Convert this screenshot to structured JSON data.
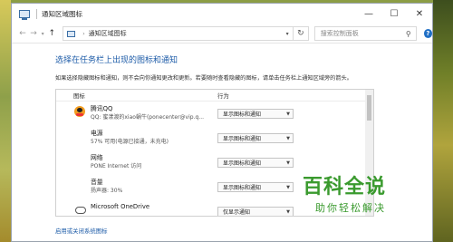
{
  "window": {
    "title": "通知区域图标",
    "controls": {
      "minimize": "—",
      "maximize": "☐",
      "close": "✕"
    }
  },
  "address": {
    "back": "←",
    "forward": "→",
    "recent": "▾",
    "up": "↑",
    "separator": "›",
    "path": "通知区域图标",
    "dropdown": "▾",
    "refresh": "↻"
  },
  "search": {
    "placeholder": "搜索控制面板",
    "icon": "search-icon"
  },
  "help": {
    "label": "?"
  },
  "page": {
    "title": "选择在任务栏上出现的图标和通知",
    "description": "如果选择隐藏图标和通知，则不会向你通知更改和更新。若要随时查看隐藏的图标，请单击任务栏上通知区域旁的箭头。"
  },
  "table": {
    "headers": {
      "icon": "图标",
      "action": "行为"
    },
    "rows": [
      {
        "name": "腾讯QQ",
        "sub": "QQ: 蜜漾渡的xiao蜗牛(ponecenter@vip.q...",
        "action": "显示图标和通知",
        "icon": "qq-icon"
      },
      {
        "name": "电源",
        "sub": "57% 可用(电源已接通，未充电)",
        "action": "显示图标和通知",
        "icon": "power-icon"
      },
      {
        "name": "网络",
        "sub": "PONE Internet 访问",
        "action": "显示图标和通知",
        "icon": "network-icon"
      },
      {
        "name": "音量",
        "sub": "扬声器: 30%",
        "action": "显示图标和通知",
        "icon": "volume-icon"
      },
      {
        "name": "Microsoft OneDrive",
        "sub": "",
        "action": "仅显示通知",
        "icon": "onedrive-icon"
      }
    ]
  },
  "footer": {
    "link": "启用或关闭系统图标"
  },
  "watermark": {
    "main": "百科全说",
    "sub": "助你轻松解决"
  }
}
